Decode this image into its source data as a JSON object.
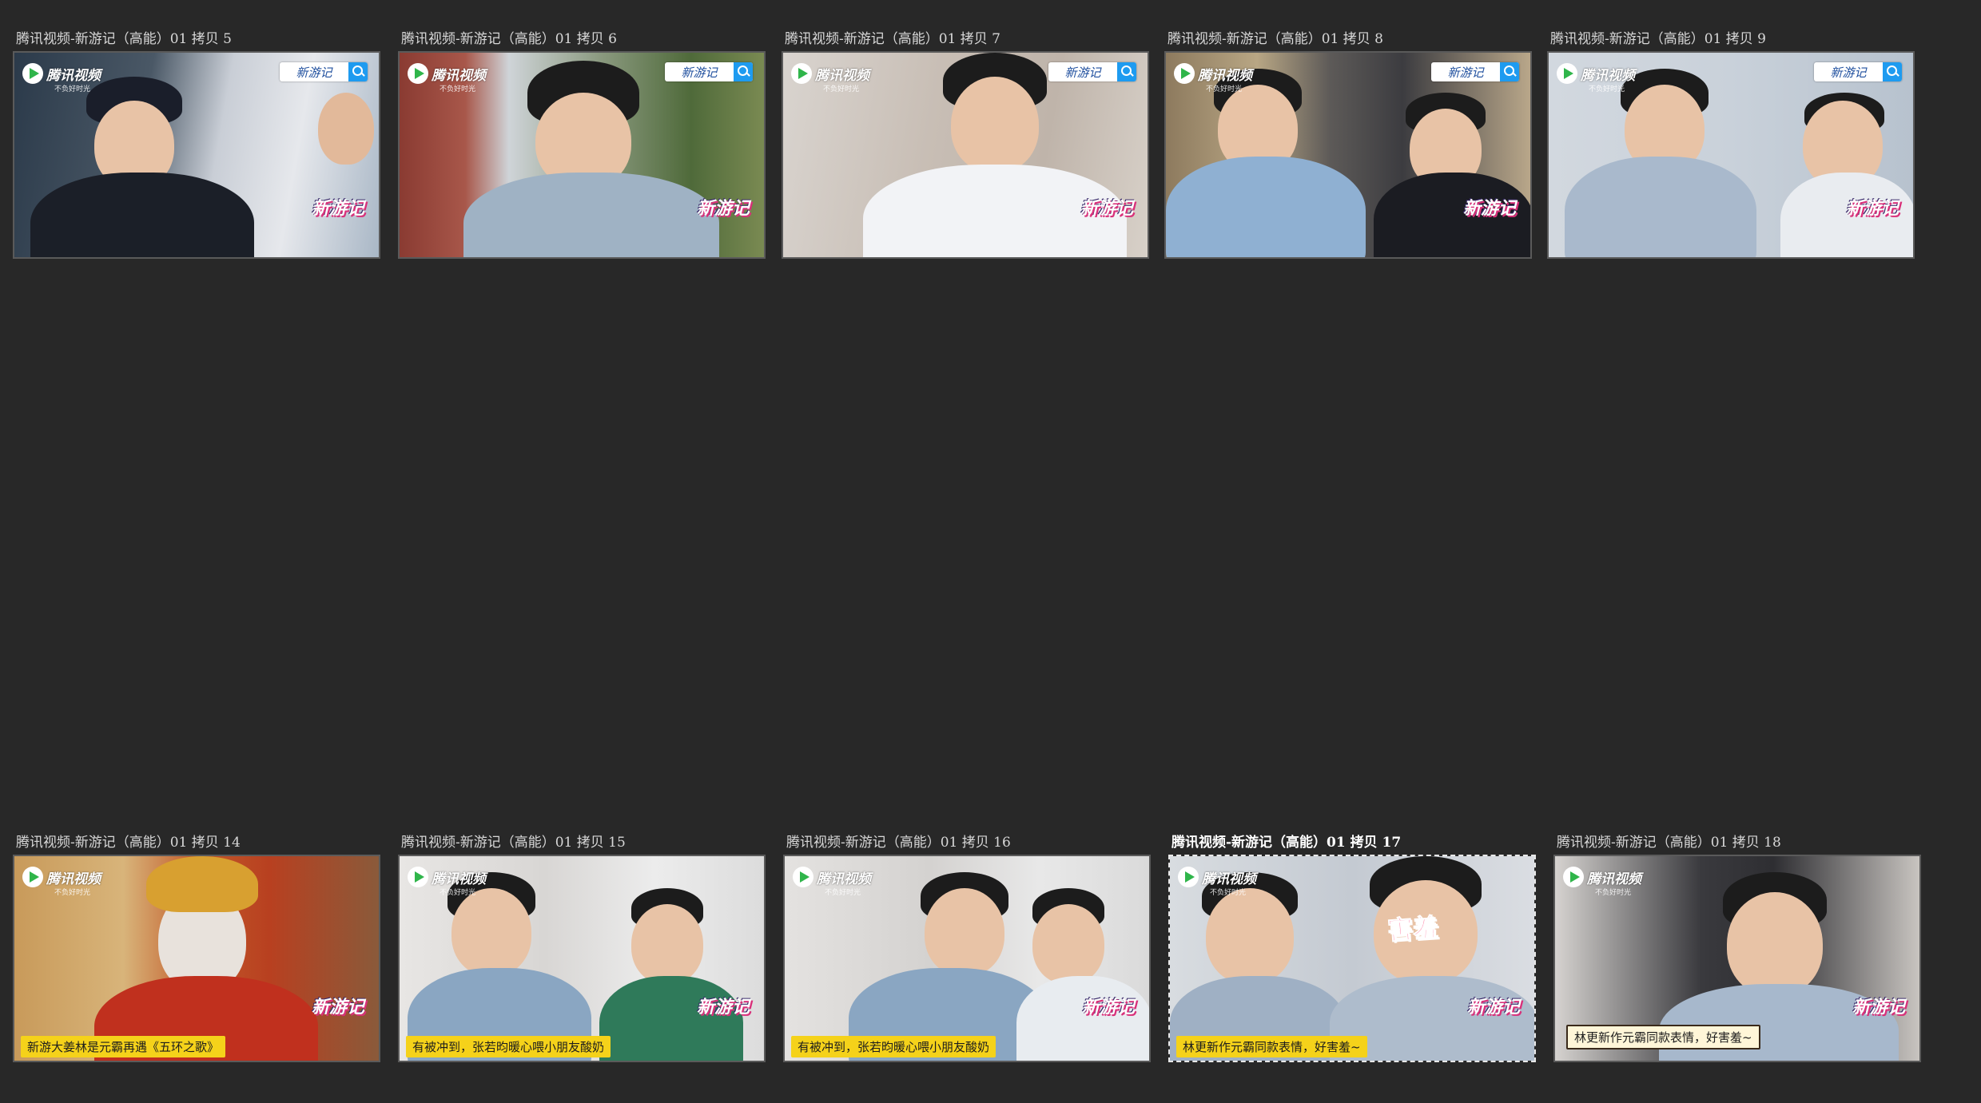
{
  "thumbnails": [
    {
      "caption": "腾讯视频-新游记（高能）01 拷贝 5",
      "logo_text": "腾讯视频",
      "logo_sub": "不负好时光",
      "search_text": "新游记",
      "show_logo": "新游记",
      "subtitle": "",
      "selected": false
    },
    {
      "caption": "腾讯视频-新游记（高能）01 拷贝 6",
      "logo_text": "腾讯视频",
      "logo_sub": "不负好时光",
      "search_text": "新游记",
      "show_logo": "新游记",
      "subtitle": "",
      "selected": false
    },
    {
      "caption": "腾讯视频-新游记（高能）01 拷贝 7",
      "logo_text": "腾讯视频",
      "logo_sub": "不负好时光",
      "search_text": "新游记",
      "show_logo": "新游记",
      "subtitle": "",
      "selected": false
    },
    {
      "caption": "腾讯视频-新游记（高能）01 拷贝 8",
      "logo_text": "腾讯视频",
      "logo_sub": "不负好时光",
      "search_text": "新游记",
      "show_logo": "新游记",
      "subtitle": "",
      "selected": false
    },
    {
      "caption": "腾讯视频-新游记（高能）01 拷贝 9",
      "logo_text": "腾讯视频",
      "logo_sub": "不负好时光",
      "search_text": "新游记",
      "show_logo": "新游记",
      "subtitle": "",
      "selected": false
    },
    {
      "caption": "腾讯视频-新游记（高能）01 拷贝 14",
      "logo_text": "腾讯视频",
      "logo_sub": "不负好时光",
      "search_text": "",
      "show_logo": "新游记",
      "subtitle": "新游大姜林是元霸再遇《五环之歌》",
      "selected": false
    },
    {
      "caption": "腾讯视频-新游记（高能）01 拷贝 15",
      "logo_text": "腾讯视频",
      "logo_sub": "不负好时光",
      "search_text": "",
      "show_logo": "新游记",
      "subtitle": "有被冲到，张若昀暖心喂小朋友酸奶",
      "selected": false
    },
    {
      "caption": "腾讯视频-新游记（高能）01 拷贝 16",
      "logo_text": "腾讯视频",
      "logo_sub": "不负好时光",
      "search_text": "",
      "show_logo": "新游记",
      "subtitle": "有被冲到，张若昀暖心喂小朋友酸奶",
      "selected": false
    },
    {
      "caption": "腾讯视频-新游记（高能）01 拷贝 17",
      "logo_text": "腾讯视频",
      "logo_sub": "不负好时光",
      "search_text": "",
      "show_logo": "新游记",
      "subtitle": "林更新作元霸同款表情，好害羞~",
      "overlay_word": "害羞",
      "selected": true
    },
    {
      "caption": "腾讯视频-新游记（高能）01 拷贝 18",
      "logo_text": "腾讯视频",
      "logo_sub": "不负好时光",
      "search_text": "",
      "show_logo": "新游记",
      "subtitle": "林更新作元霸同款表情，好害羞~",
      "selected": false
    }
  ]
}
